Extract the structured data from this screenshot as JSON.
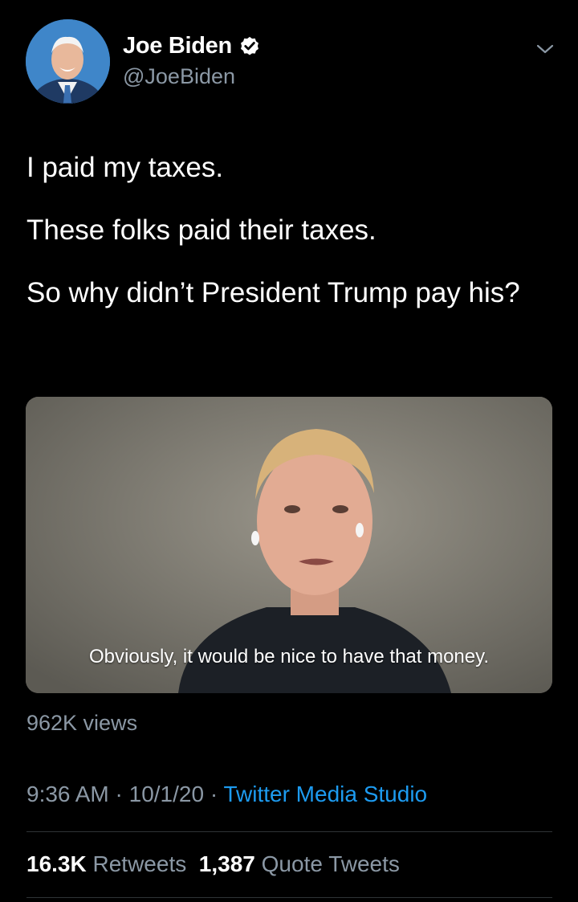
{
  "header": {
    "display_name": "Joe Biden",
    "handle": "@JoeBiden",
    "verified": true,
    "icons": {
      "avatar": "profile-photo",
      "verified": "verified-badge-icon",
      "menu": "chevron-down-icon"
    }
  },
  "tweet": {
    "paragraphs": [
      "I paid my taxes.",
      "These folks paid their taxes.",
      "So why didn’t President Trump pay his?"
    ]
  },
  "media": {
    "caption": "Obviously, it would be nice to have that money."
  },
  "views": "962K views",
  "meta": {
    "time": "9:36 AM",
    "separator": " · ",
    "date": "10/1/20",
    "source": "Twitter Media Studio"
  },
  "stats": {
    "retweets_count": "16.3K",
    "retweets_label": "Retweets",
    "quotes_count": "1,387",
    "quotes_label": "Quote Tweets"
  },
  "colors": {
    "background": "#000000",
    "text": "#ffffff",
    "secondary": "#8b98a5",
    "link": "#1d9bf0",
    "divider": "#2f3336"
  }
}
